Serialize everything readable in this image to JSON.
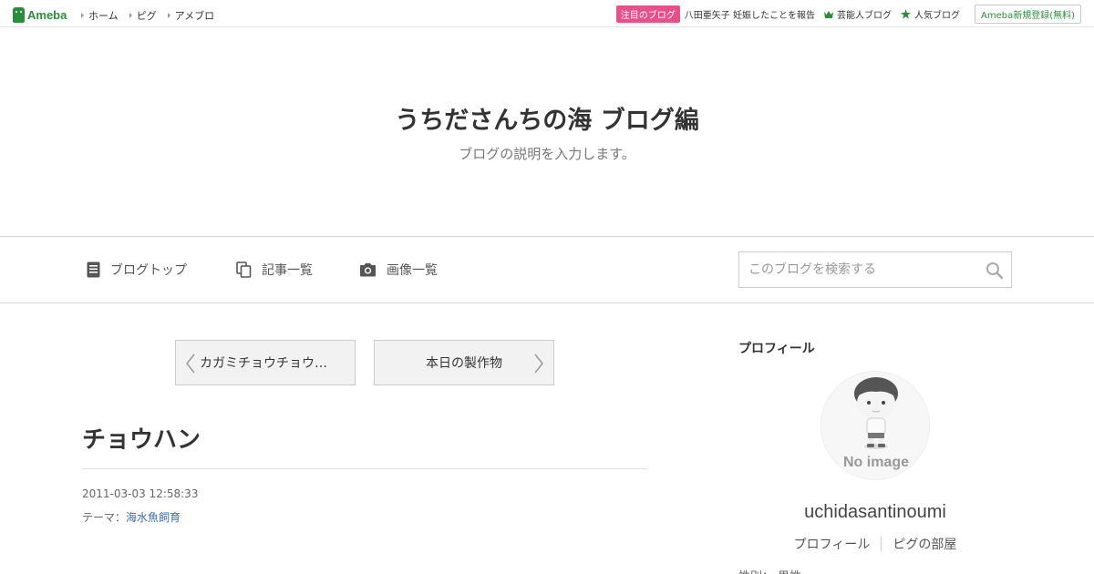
{
  "topbar": {
    "logo_text": "Ameba",
    "nav": [
      "ホーム",
      "ピグ",
      "アメブロ"
    ],
    "hot_badge": "注目のブログ",
    "hot_link": "八田亜矢子 妊娠したことを報告",
    "entertainer_link": "芸能人ブログ",
    "popular_link": "人気ブログ",
    "signup": "Ameba新規登録(無料)",
    "brand_color": "#2d8c3c",
    "badge_color": "#e8508a"
  },
  "header": {
    "title": "うちださんちの海 ブログ編",
    "description": "ブログの説明を入力します。"
  },
  "navbar": {
    "items": [
      {
        "label": "ブログトップ",
        "icon": "document-icon"
      },
      {
        "label": "記事一覧",
        "icon": "copy-icon"
      },
      {
        "label": "画像一覧",
        "icon": "camera-icon"
      }
    ],
    "search_placeholder": "このブログを検索する"
  },
  "pager": {
    "prev": "カガミチョウチョウ…",
    "next": "本日の製作物"
  },
  "entry": {
    "title": "チョウハン",
    "date": "2011-03-03 12:58:33",
    "theme_label": "テーマ：",
    "theme": "海水魚飼育"
  },
  "sidebar": {
    "heading": "プロフィール",
    "noimage": "No image",
    "user_name": "uchidasantinoumi",
    "links": [
      "プロフィール",
      "ピグの部屋"
    ],
    "cut_text": "性別： 男性"
  }
}
